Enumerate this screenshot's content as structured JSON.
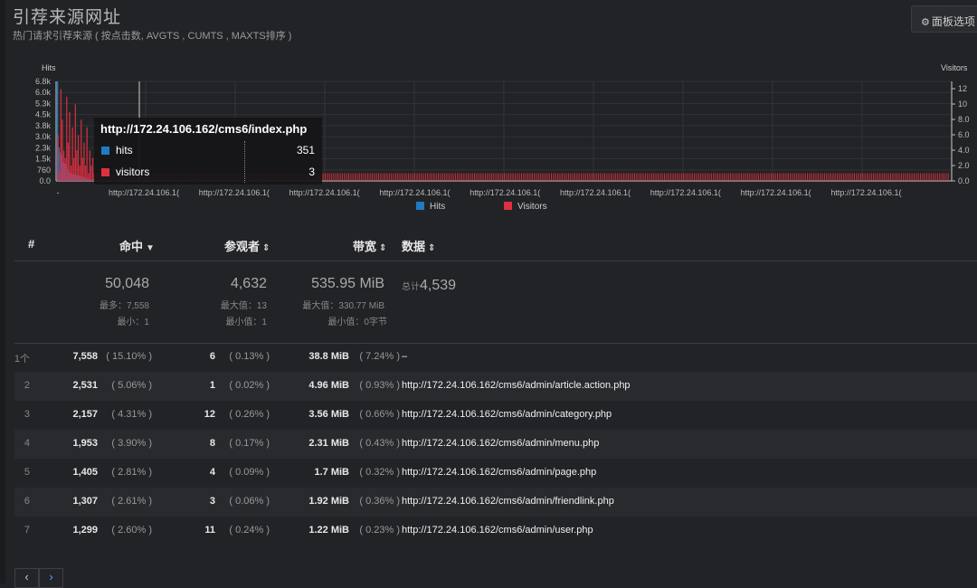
{
  "page": {
    "title": "引荐来源网址",
    "subtitle": "热门请求引荐来源 ( 按点击数, AVGTS , CUMTS , MAXTS排序 )",
    "panel_button": "面板选项"
  },
  "icons": {
    "panel_button": "gear-icon",
    "prev": "chevron-left-icon",
    "next": "chevron-right-icon"
  },
  "colors": {
    "hits": "#1e7bc4",
    "visitors": "#e03040",
    "background": "#222326"
  },
  "chart_data": {
    "type": "bar",
    "left_axis_label": "Hits",
    "right_axis_label": "Visitors",
    "left_ticks": [
      "6.8k",
      "6.0k",
      "5.3k",
      "4.5k",
      "3.8k",
      "3.0k",
      "2.3k",
      "1.5k",
      "760",
      "0.0"
    ],
    "right_ticks": [
      "12",
      "10",
      "8.0",
      "6.0",
      "4.0",
      "2.0",
      "0.0"
    ],
    "ylim_left": [
      0,
      7558
    ],
    "ylim_right": [
      0,
      13
    ],
    "x_ticks": [
      "-",
      "http://172.24.106.1(",
      "http://172.24.106.1(",
      "http://172.24.106.1(",
      "http://172.24.106.1(",
      "http://172.24.106.1(",
      "http://172.24.106.1(",
      "http://172.24.106.1(",
      "http://172.24.106.1(",
      "http://172.24.106.1("
    ],
    "series": [
      {
        "name": "Hits",
        "values": [
          7558,
          2531,
          2157,
          1953,
          1405,
          1307,
          1299,
          900,
          760,
          600,
          560,
          520,
          480,
          450,
          430,
          410,
          380,
          351,
          300,
          250,
          200,
          180,
          150,
          120,
          100,
          80
        ]
      },
      {
        "name": "Visitors",
        "values": [
          6,
          1,
          12,
          8,
          4,
          3,
          11,
          5,
          9,
          2,
          7,
          3,
          10,
          4,
          6,
          2,
          8,
          3,
          5,
          2,
          7,
          1,
          4,
          2,
          3,
          1
        ]
      }
    ],
    "filler_visitor_value": 1,
    "filler_bar_count": 400,
    "legend": [
      "Hits",
      "Visitors"
    ],
    "legend_position": "bottom"
  },
  "tooltip": {
    "title": "http://172.24.106.162/cms6/index.php",
    "rows": [
      {
        "label": "hits",
        "value": "351"
      },
      {
        "label": "visitors",
        "value": "3"
      }
    ]
  },
  "table": {
    "headers": {
      "index": "#",
      "hits": "命中",
      "visitors": "参观者",
      "bandwidth": "带宽",
      "data": "数据"
    },
    "summary": {
      "hits_total": "50,048",
      "hits_max": "最多：7,558",
      "hits_min": "最小：1",
      "visitors_total": "4,632",
      "visitors_max": "最大值：13",
      "visitors_min": "最小值：1",
      "bw_total": "535.95 MiB",
      "bw_max": "最大值：330.77 MiB",
      "bw_min": "最小值：0字节",
      "data_label": "总计",
      "data_total": "4,539"
    },
    "rows": [
      {
        "idx": "1个",
        "hits": "7,558",
        "hits_pct": "( 15.10% )",
        "visitors": "6",
        "visitors_pct": "( 0.13% )",
        "bw": "38.8 MiB",
        "bw_pct": "( 7.24% )",
        "data": "–"
      },
      {
        "idx": "2",
        "hits": "2,531",
        "hits_pct": "( 5.06% )",
        "visitors": "1",
        "visitors_pct": "( 0.02% )",
        "bw": "4.96 MiB",
        "bw_pct": "( 0.93% )",
        "data": "http://172.24.106.162/cms6/admin/article.action.php"
      },
      {
        "idx": "3",
        "hits": "2,157",
        "hits_pct": "( 4.31% )",
        "visitors": "12",
        "visitors_pct": "( 0.26% )",
        "bw": "3.56 MiB",
        "bw_pct": "( 0.66% )",
        "data": "http://172.24.106.162/cms6/admin/category.php"
      },
      {
        "idx": "4",
        "hits": "1,953",
        "hits_pct": "( 3.90% )",
        "visitors": "8",
        "visitors_pct": "( 0.17% )",
        "bw": "2.31 MiB",
        "bw_pct": "( 0.43% )",
        "data": "http://172.24.106.162/cms6/admin/menu.php"
      },
      {
        "idx": "5",
        "hits": "1,405",
        "hits_pct": "( 2.81% )",
        "visitors": "4",
        "visitors_pct": "( 0.09% )",
        "bw": "1.7 MiB",
        "bw_pct": "( 0.32% )",
        "data": "http://172.24.106.162/cms6/admin/page.php"
      },
      {
        "idx": "6",
        "hits": "1,307",
        "hits_pct": "( 2.61% )",
        "visitors": "3",
        "visitors_pct": "( 0.06% )",
        "bw": "1.92 MiB",
        "bw_pct": "( 0.36% )",
        "data": "http://172.24.106.162/cms6/admin/friendlink.php"
      },
      {
        "idx": "7",
        "hits": "1,299",
        "hits_pct": "( 2.60% )",
        "visitors": "11",
        "visitors_pct": "( 0.24% )",
        "bw": "1.22 MiB",
        "bw_pct": "( 0.23% )",
        "data": "http://172.24.106.162/cms6/admin/user.php"
      }
    ]
  },
  "pager": {
    "prev": "‹",
    "next": "›"
  }
}
